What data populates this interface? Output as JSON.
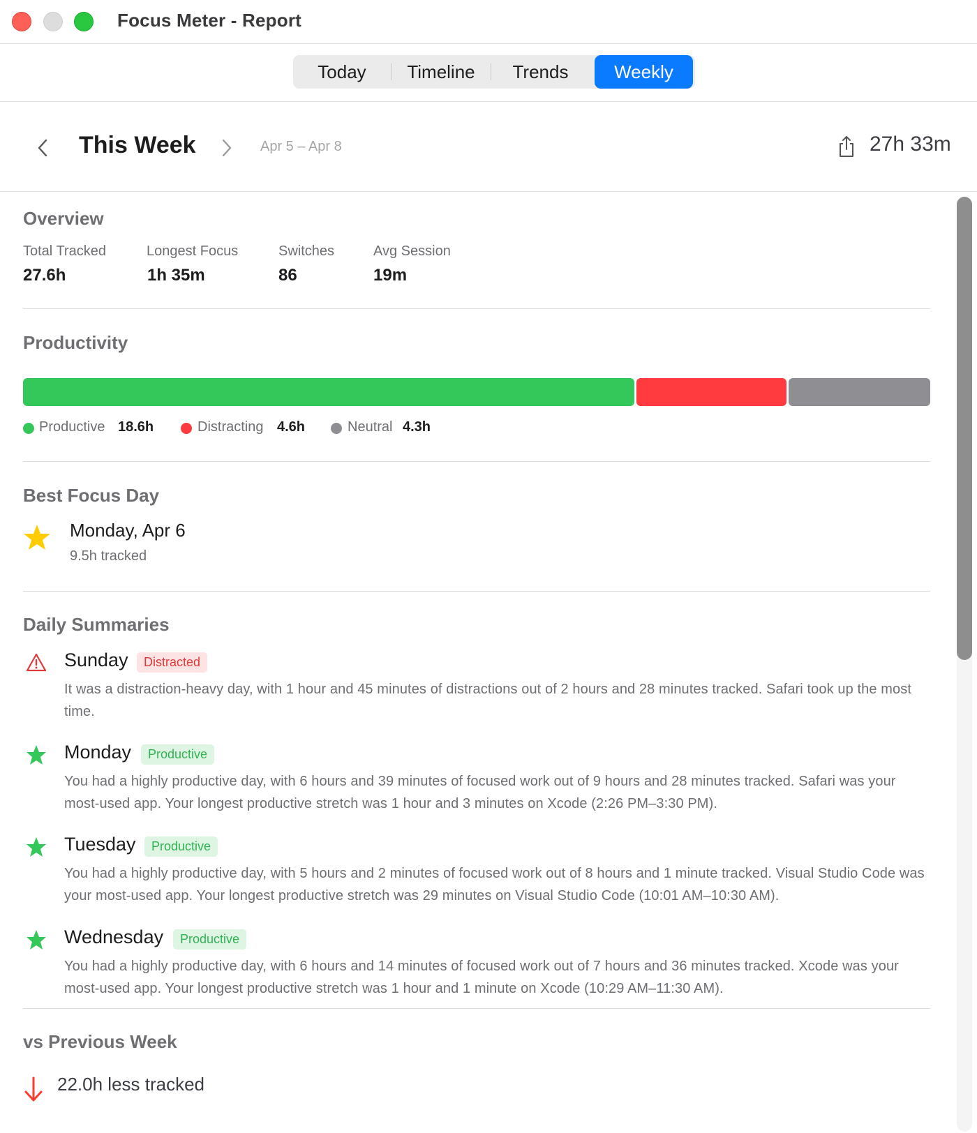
{
  "window": {
    "title": "Focus Meter - Report"
  },
  "tabs": [
    {
      "label": "Today",
      "active": false
    },
    {
      "label": "Timeline",
      "active": false
    },
    {
      "label": "Trends",
      "active": false
    },
    {
      "label": "Weekly",
      "active": true
    }
  ],
  "week_header": {
    "title": "This Week",
    "range": "Apr 5 – Apr 8",
    "total": "27h 33m",
    "prev_icon": "chevron-left-icon",
    "next_icon": "chevron-right-icon",
    "share_icon": "share-icon"
  },
  "overview": {
    "title": "Overview",
    "stats": [
      {
        "label": "Total Tracked",
        "value": "27.6h"
      },
      {
        "label": "Longest Focus",
        "value": "1h 35m"
      },
      {
        "label": "Switches",
        "value": "86"
      },
      {
        "label": "Avg Session",
        "value": "19m"
      }
    ]
  },
  "productivity": {
    "title": "Productivity",
    "segments": [
      {
        "label": "Productive",
        "value": "18.6h",
        "hours": 18.6,
        "color": "#34c759"
      },
      {
        "label": "Distracting",
        "value": "4.6h",
        "hours": 4.6,
        "color": "#ff3b3f"
      },
      {
        "label": "Neutral",
        "value": "4.3h",
        "hours": 4.3,
        "color": "#8e8e93"
      }
    ]
  },
  "best_focus_day": {
    "title": "Best Focus Day",
    "day": "Monday, Apr 6",
    "subtitle": "9.5h tracked",
    "icon": "star-icon",
    "color": "#ffcc00"
  },
  "daily_summaries": {
    "title": "Daily Summaries",
    "days": [
      {
        "name": "Sunday",
        "badge": "Distracted",
        "icon": "warning-triangle-icon",
        "text": "It was a distraction-heavy day, with 1 hour and 45 minutes of distractions out of 2 hours and 28 minutes tracked. Safari took up the most time."
      },
      {
        "name": "Monday",
        "badge": "Productive",
        "icon": "star-icon",
        "text": "You had a highly productive day, with 6 hours and 39 minutes of focused work out of 9 hours and 28 minutes tracked. Safari was your most-used app. Your longest productive stretch was 1 hour and 3 minutes on Xcode (2:26 PM–3:30 PM)."
      },
      {
        "name": "Tuesday",
        "badge": "Productive",
        "icon": "star-icon",
        "text": "You had a highly productive day, with 5 hours and 2 minutes of focused work out of 8 hours and 1 minute tracked. Visual Studio Code was your most-used app. Your longest productive stretch was 29 minutes on Visual Studio Code (10:01 AM–10:30 AM)."
      },
      {
        "name": "Wednesday",
        "badge": "Productive",
        "icon": "star-icon",
        "text": "You had a highly productive day, with 6 hours and 14 minutes of focused work out of 7 hours and 36 minutes tracked. Xcode was your most-used app. Your longest productive stretch was 1 hour and 1 minute on Xcode (10:29 AM–11:30 AM)."
      }
    ]
  },
  "comparison": {
    "title": "vs Previous Week",
    "text": "22.0h less tracked",
    "icon": "arrow-down-icon",
    "color": "#ff3b30"
  }
}
